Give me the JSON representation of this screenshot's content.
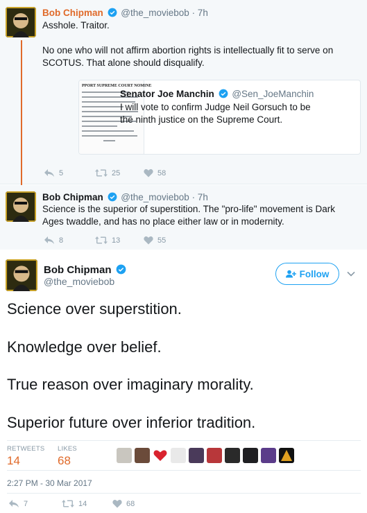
{
  "reply1": {
    "name": "Bob Chipman",
    "handle": "@the_moviebob",
    "time": "· 7h",
    "text_line1": "Asshole. Traitor.",
    "text_para2": "No one who will not affirm abortion rights is intellectually fit to serve on SCOTUS. That alone should disqualify.",
    "quote": {
      "thumb_headline": "PPORT SUPREME COURT NOMINE",
      "name": "Senator Joe Manchin",
      "handle": "@Sen_JoeManchin",
      "text": "I will vote to confirm Judge Neil Gorsuch to be the ninth justice on the Supreme Court."
    },
    "replies": "5",
    "retweets": "25",
    "likes": "58"
  },
  "reply2": {
    "name": "Bob Chipman",
    "handle": "@the_moviebob",
    "time": "· 7h",
    "text": "Science is the superior of superstition. The \"pro-life\" movement is Dark Ages twaddle, and has no place either law or in modernity.",
    "replies": "8",
    "retweets": "13",
    "likes": "55"
  },
  "main": {
    "name": "Bob Chipman",
    "handle": "@the_moviebob",
    "follow_label": "Follow",
    "lines": [
      "Science over superstition.",
      "Knowledge over belief.",
      "True reason over imaginary morality.",
      "Superior future over inferior tradition."
    ],
    "retweets_label": "RETWEETS",
    "retweets_count": "14",
    "likes_label": "LIKES",
    "likes_count": "68",
    "timestamp": "2:27 PM - 30 Mar 2017",
    "replies": "7",
    "retweets": "14",
    "likes": "68"
  },
  "colors": {
    "accent_orange": "#e06a2a",
    "twitter_blue": "#1da1f2",
    "muted_gray": "#8899a6",
    "like_red": "#e0245e"
  },
  "icons": [
    "verified-badge-icon",
    "reply-icon",
    "retweet-icon",
    "heart-icon",
    "add-user-icon",
    "chevron-down-icon"
  ]
}
